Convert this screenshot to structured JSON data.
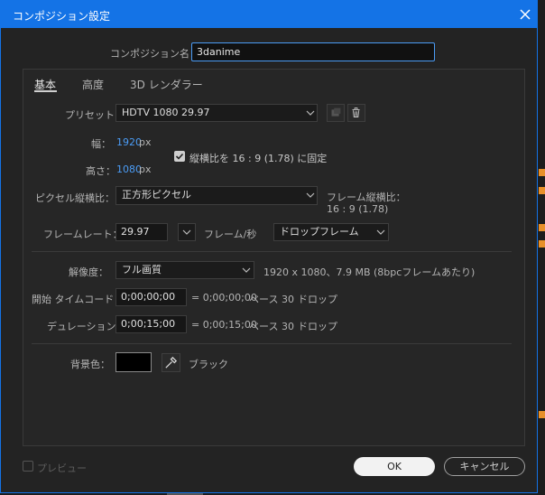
{
  "window": {
    "title": "コンポジション設定"
  },
  "name_field": {
    "label": "コンポジション名：",
    "value": "3danime"
  },
  "tabs": [
    {
      "label": "基本",
      "active": true
    },
    {
      "label": "高度",
      "active": false
    },
    {
      "label": "3D レンダラー",
      "active": false
    }
  ],
  "preset": {
    "label": "プリセット：",
    "value": "HDTV 1080 29.97"
  },
  "width": {
    "label": "幅：",
    "value": "1920",
    "unit": "px"
  },
  "height": {
    "label": "高さ：",
    "value": "1080",
    "unit": "px"
  },
  "aspect_lock": {
    "label": "縦横比を 16 : 9 (1.78) に固定",
    "checked": true
  },
  "pixel_aspect": {
    "label": "ピクセル縦横比：",
    "value": "正方形ピクセル"
  },
  "frame_aspect": {
    "label": "フレーム縦横比：",
    "value": "16 : 9 (1.78)"
  },
  "frame_rate": {
    "label": "フレームレート：",
    "value": "29.97",
    "unit": "フレーム/秒",
    "mode": "ドロップフレーム"
  },
  "resolution": {
    "label": "解像度：",
    "value": "フル画質",
    "info": "1920 x 1080、7.9 MB (8bpcフレームあたり)"
  },
  "start_timecode": {
    "label": "開始 タイムコード：",
    "value": "0;00;00;00",
    "info_eq": "= 0;00;00;00",
    "info_base": "ベース 30",
    "info_drop": "ドロップ"
  },
  "duration": {
    "label": "デュレーション：",
    "value": "0;00;15;00",
    "info_eq": "= 0;00;15;00",
    "info_base": "ベース 30",
    "info_drop": "ドロップ"
  },
  "background": {
    "label": "背景色：",
    "color": "#000000",
    "name": "ブラック"
  },
  "preview": {
    "label": "プレビュー",
    "checked": false
  },
  "buttons": {
    "ok": "OK",
    "cancel": "キャンセル"
  },
  "colors": {
    "accent": "#1473e6",
    "link_blue": "#4b9cf5"
  }
}
